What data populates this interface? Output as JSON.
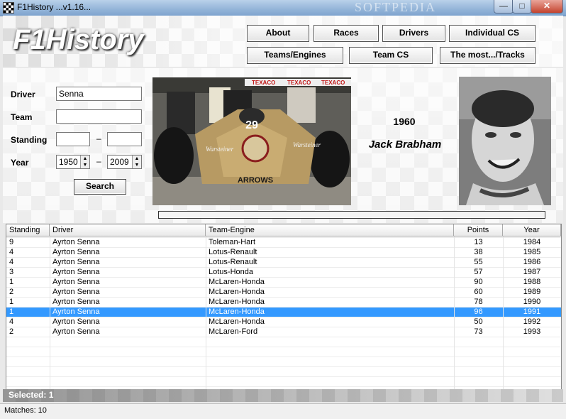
{
  "window": {
    "title": "F1History ...v1.16...",
    "watermark": "SOFTPEDIA"
  },
  "logo": "F1History",
  "nav": {
    "about": "About",
    "races": "Races",
    "drivers": "Drivers",
    "individual_cs": "Individual CS",
    "teams_engines": "Teams/Engines",
    "team_cs": "Team CS",
    "the_most_tracks": "The most.../Tracks"
  },
  "filters": {
    "driver_label": "Driver",
    "driver_value": "Senna",
    "team_label": "Team",
    "team_value": "",
    "standing_label": "Standing",
    "standing_from": "",
    "standing_to": "",
    "year_label": "Year",
    "year_from": "1950",
    "year_to": "2009",
    "dash": "–",
    "search_label": "Search"
  },
  "champion": {
    "year": "1960",
    "name": "Jack Brabham"
  },
  "car_photo": {
    "sponsor_top": "TEXACO",
    "car_number": "29",
    "team_text": "ARROWS",
    "sponsor_side": "Warsteiner"
  },
  "table": {
    "columns": [
      "Standing",
      "Driver",
      "Team-Engine",
      "Points",
      "Year"
    ],
    "rows": [
      {
        "standing": "9",
        "driver": "Ayrton Senna",
        "team": "Toleman-Hart",
        "points": "13",
        "year": "1984"
      },
      {
        "standing": "4",
        "driver": "Ayrton Senna",
        "team": "Lotus-Renault",
        "points": "38",
        "year": "1985"
      },
      {
        "standing": "4",
        "driver": "Ayrton Senna",
        "team": "Lotus-Renault",
        "points": "55",
        "year": "1986"
      },
      {
        "standing": "3",
        "driver": "Ayrton Senna",
        "team": "Lotus-Honda",
        "points": "57",
        "year": "1987"
      },
      {
        "standing": "1",
        "driver": "Ayrton Senna",
        "team": "McLaren-Honda",
        "points": "90",
        "year": "1988"
      },
      {
        "standing": "2",
        "driver": "Ayrton Senna",
        "team": "McLaren-Honda",
        "points": "60",
        "year": "1989"
      },
      {
        "standing": "1",
        "driver": "Ayrton Senna",
        "team": "McLaren-Honda",
        "points": "78",
        "year": "1990"
      },
      {
        "standing": "1",
        "driver": "Ayrton Senna",
        "team": "McLaren-Honda",
        "points": "96",
        "year": "1991",
        "selected": true
      },
      {
        "standing": "4",
        "driver": "Ayrton Senna",
        "team": "McLaren-Honda",
        "points": "50",
        "year": "1992"
      },
      {
        "standing": "2",
        "driver": "Ayrton Senna",
        "team": "McLaren-Ford",
        "points": "73",
        "year": "1993"
      }
    ]
  },
  "selected_text": "Selected: 1",
  "status_text": "Matches: 10",
  "colors": {
    "selection": "#3399ff",
    "title_bar": "#93b4d8"
  }
}
